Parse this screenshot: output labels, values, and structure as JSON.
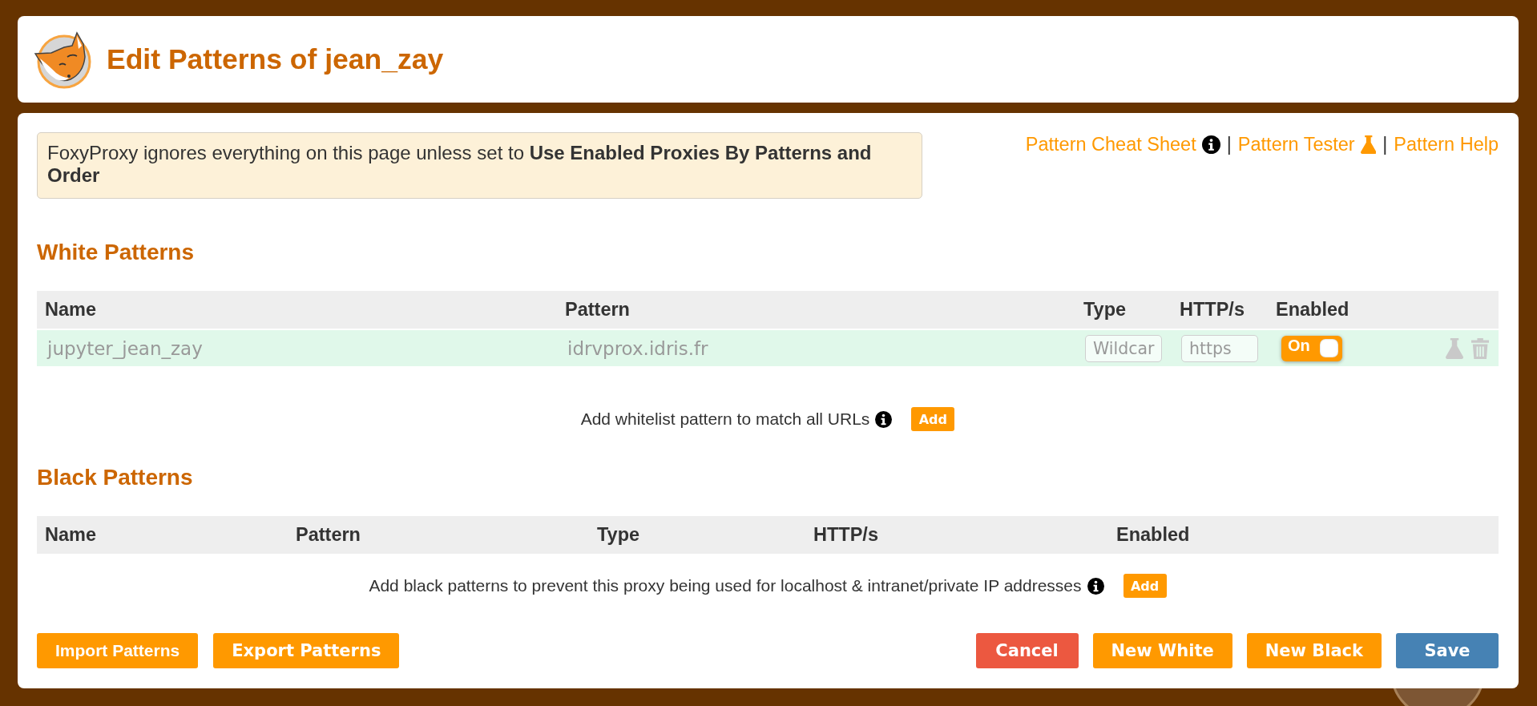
{
  "header": {
    "title": "Edit Patterns of jean_zay"
  },
  "notice": {
    "text": "FoxyProxy ignores everything on this page unless set to **Use Enabled Proxies By Patterns and Order**"
  },
  "help_links": [
    {
      "kind": "cheat_sheet",
      "label": "Pattern Cheat Sheet"
    },
    {
      "kind": "tester",
      "separator": "|",
      "label": "Pattern Tester"
    },
    {
      "kind": "help",
      "separator": "|",
      "label": "Pattern Help"
    }
  ],
  "white_patterns": {
    "title": "White Patterns",
    "columns": [
      "Name",
      "Pattern",
      "Type",
      "HTTP/s",
      "Enabled"
    ],
    "rows": [
      {
        "name": "jupyter_jean_zay",
        "pattern": "idrvprox.idris.fr",
        "type": "Wildcar",
        "protocol": "https",
        "enabled": true,
        "enabled_label": "On"
      }
    ],
    "hint": "Add whitelist pattern to match all URLs",
    "add_button": "Add"
  },
  "black_patterns": {
    "title": "Black Patterns",
    "columns": [
      "Name",
      "Pattern",
      "Type",
      "HTTP/s",
      "Enabled"
    ],
    "hint": "Add black patterns to prevent this proxy being used for localhost & intranet/private IP addresses",
    "add_button": "Add"
  },
  "footer": {
    "left_buttons": [
      {
        "label": "Import Patterns",
        "kind": "default"
      },
      {
        "label": "Export Patterns",
        "kind": "default"
      }
    ],
    "right_buttons": [
      {
        "label": "Cancel",
        "kind": "danger"
      },
      {
        "label": "New White",
        "kind": "default"
      },
      {
        "label": "New Black",
        "kind": "default"
      },
      {
        "label": "Save",
        "kind": "primary"
      }
    ]
  }
}
